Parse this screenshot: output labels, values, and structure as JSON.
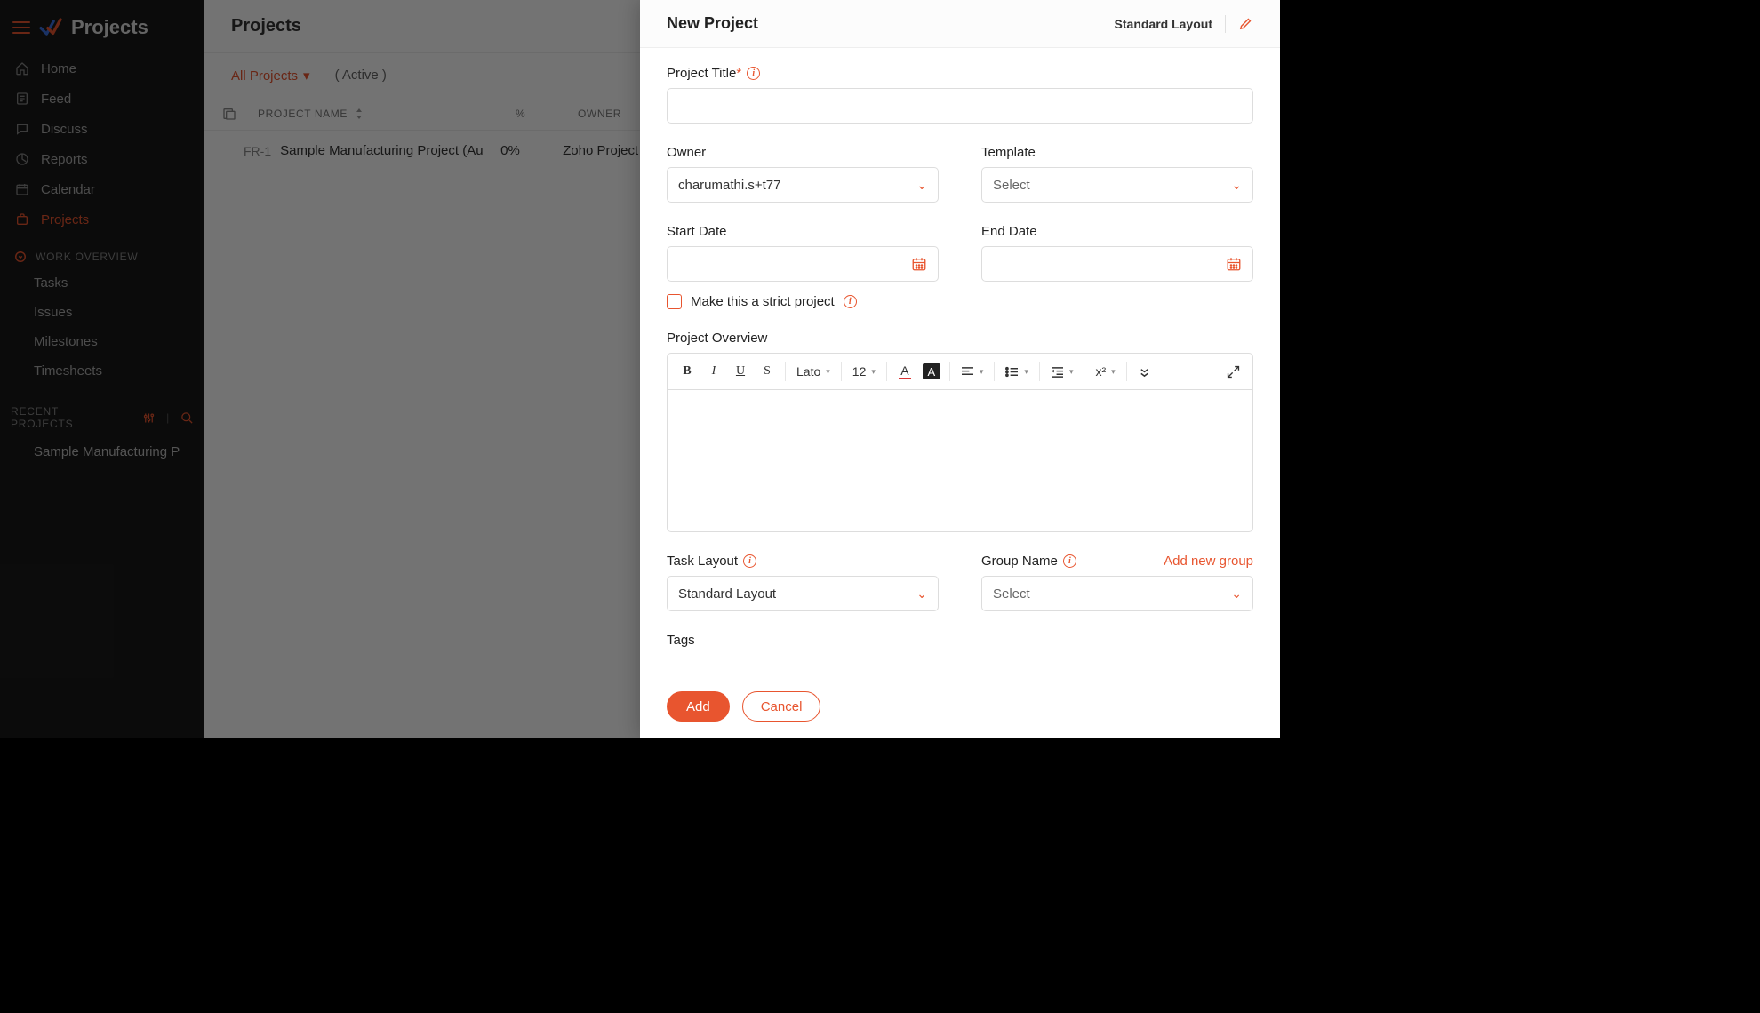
{
  "brand": {
    "title": "Projects"
  },
  "sidebar": {
    "items": [
      {
        "label": "Home"
      },
      {
        "label": "Feed"
      },
      {
        "label": "Discuss"
      },
      {
        "label": "Reports"
      },
      {
        "label": "Calendar"
      },
      {
        "label": "Projects"
      }
    ],
    "work_overview_label": "WORK OVERVIEW",
    "work_items": [
      {
        "label": "Tasks"
      },
      {
        "label": "Issues"
      },
      {
        "label": "Milestones"
      },
      {
        "label": "Timesheets"
      }
    ],
    "recent_label": "RECENT PROJECTS",
    "recent_items": [
      {
        "label": "Sample Manufacturing P"
      }
    ]
  },
  "main": {
    "title": "Projects",
    "filter_link": "All Projects",
    "filter_status": "( Active )",
    "columns": {
      "name": "PROJECT NAME",
      "pct": "%",
      "owner": "OWNER"
    },
    "rows": [
      {
        "id": "FR-1",
        "name": "Sample Manufacturing Project (Au",
        "pct": "0%",
        "owner": "Zoho Project"
      }
    ]
  },
  "panel": {
    "title": "New Project",
    "layout_name": "Standard Layout",
    "project_title_label": "Project Title",
    "owner_label": "Owner",
    "owner_value": "charumathi.s+t77",
    "template_label": "Template",
    "template_value": "Select",
    "start_date_label": "Start Date",
    "end_date_label": "End Date",
    "strict_label": "Make this a strict project",
    "overview_label": "Project Overview",
    "toolbar": {
      "font": "Lato",
      "size": "12",
      "script": "x²"
    },
    "task_layout_label": "Task Layout",
    "task_layout_value": "Standard Layout",
    "group_name_label": "Group Name",
    "group_name_value": "Select",
    "add_group_link": "Add new group",
    "tags_label": "Tags",
    "add_btn": "Add",
    "cancel_btn": "Cancel"
  }
}
